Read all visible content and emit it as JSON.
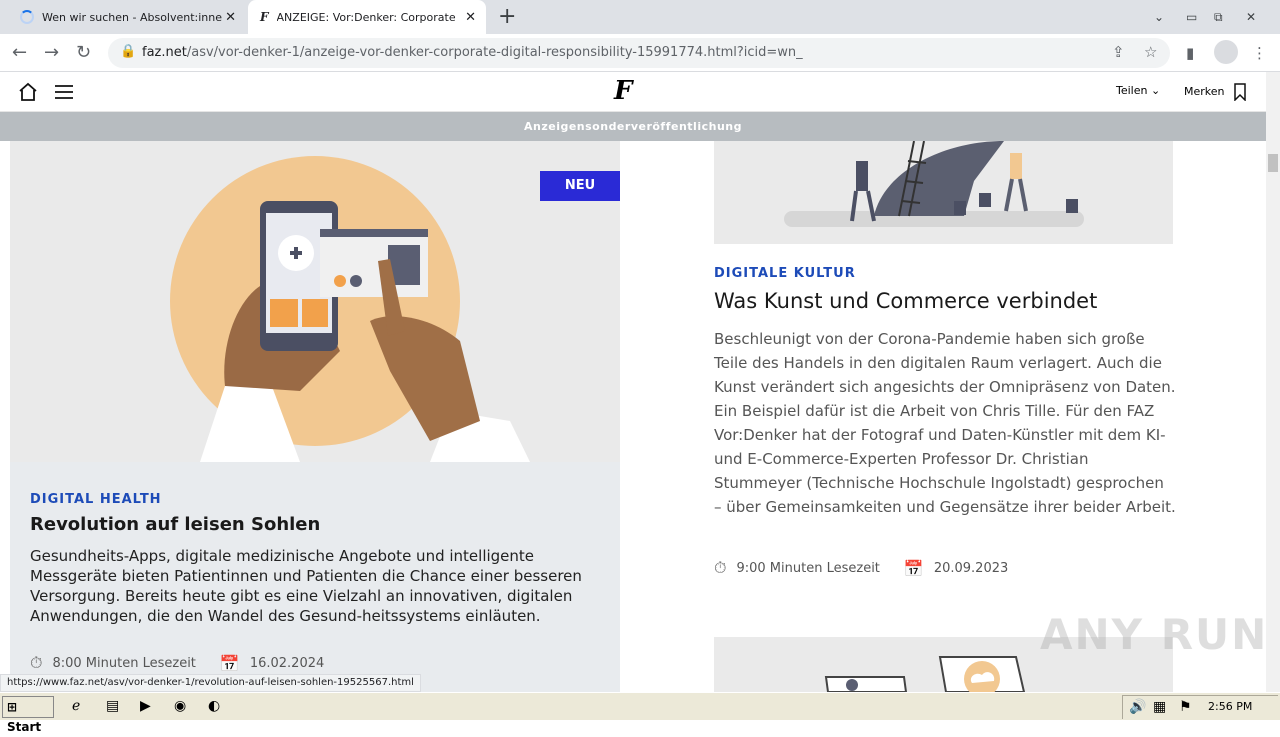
{
  "browser": {
    "tabs": [
      {
        "title": "Wen wir suchen - Absolvent:innen | ",
        "close": "✕"
      },
      {
        "title": "ANZEIGE: Vor:Denker: Corporate Di",
        "close": "✕"
      }
    ],
    "new_tab": "+",
    "url_host": "faz.net",
    "url_path": "/asv/vor-denker-1/anzeige-vor-denker-corporate-digital-responsibility-15991774.html?icid=wn_",
    "status_url": "https://www.faz.net/asv/vor-denker-1/revolution-auf-leisen-sohlen-19525567.html"
  },
  "site": {
    "teilen": "Teilen",
    "merken": "Merken",
    "banner": "Anzeigensonderveröffentlichung"
  },
  "card1": {
    "badge": "NEU",
    "category": "DIGITAL HEALTH",
    "headline": "Revolution auf leisen Sohlen",
    "text": "Gesundheits-Apps, digitale medizinische Angebote und intelligente Messgeräte bieten Patientinnen und Patienten die Chance einer besseren Versorgung. Bereits heute gibt es eine Vielzahl an innovativen, digitalen Anwendungen, die den Wandel des Gesund-heitssystems einläuten.",
    "readtime": "8:00 Minuten Lesezeit",
    "date": "16.02.2024"
  },
  "card2": {
    "category": "DIGITALE KULTUR",
    "headline": "Was Kunst und Commerce verbindet",
    "text": "Beschleunigt von der Corona-Pandemie haben sich große Teile des Handels in den digitalen Raum verlagert. Auch die Kunst verändert sich angesichts der Omnipräsenz von Daten. Ein Beispiel dafür ist die Arbeit von Chris Tille. Für den FAZ Vor:Denker hat der Fotograf und Daten-Künstler mit dem KI- und E-Commerce-Experten Professor Dr. Christian Stummeyer (Technische Hochschule Ingolstadt) gesprochen – über Gemeinsamkeiten und Gegensätze ihrer beider Arbeit.",
    "readtime": "9:00 Minuten Lesezeit",
    "date": "20.09.2023"
  },
  "watermark": "ANY RUN",
  "taskbar": {
    "start": "Start",
    "clock": "2:56 PM"
  }
}
